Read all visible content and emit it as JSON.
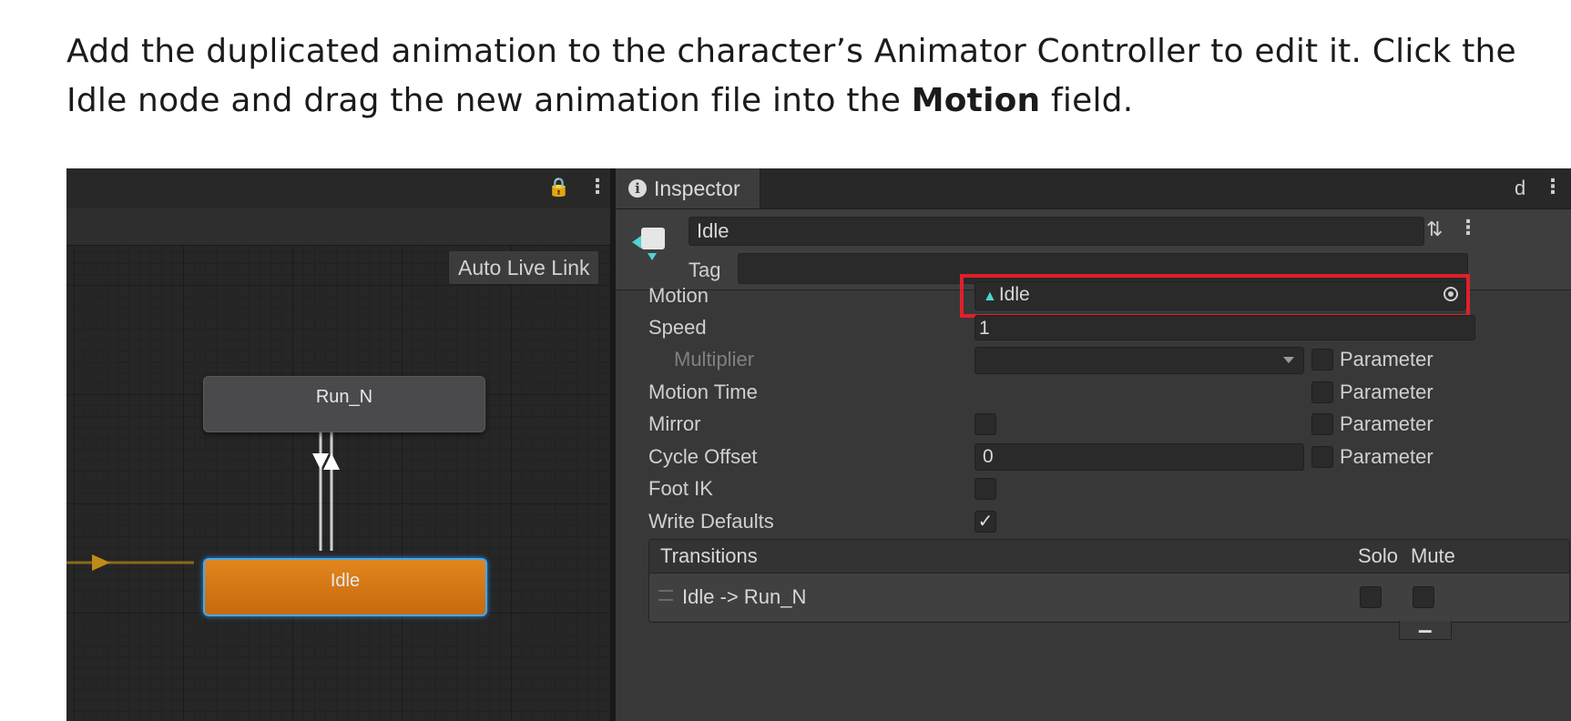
{
  "intro": {
    "before": "Add the duplicated animation to the character’s Animator Controller to edit it. Click the Idle node and drag the new animation file into the ",
    "bold": "Motion",
    "after": " field."
  },
  "animator": {
    "auto_live_link": "Auto Live Link",
    "nodes": {
      "run": "Run_N",
      "idle": "Idle"
    }
  },
  "inspector": {
    "tab_label": "Inspector",
    "state_name": "Idle",
    "tag_label": "Tag",
    "tag_value": "",
    "motion": {
      "label": "Motion",
      "value": "Idle"
    },
    "speed": {
      "label": "Speed",
      "value": "1"
    },
    "multiplier": {
      "label": "Multiplier",
      "parameter": "Parameter"
    },
    "motion_time": {
      "label": "Motion Time",
      "parameter": "Parameter"
    },
    "mirror": {
      "label": "Mirror",
      "parameter": "Parameter"
    },
    "cycle_offset": {
      "label": "Cycle Offset",
      "value": "0",
      "parameter": "Parameter"
    },
    "foot_ik": {
      "label": "Foot IK"
    },
    "write_defaults": {
      "label": "Write Defaults",
      "checked": true
    },
    "transitions": {
      "title": "Transitions",
      "solo": "Solo",
      "mute": "Mute",
      "items": [
        {
          "label": "Idle -> Run_N"
        }
      ]
    }
  },
  "colors": {
    "highlight": "#e0202a",
    "idle_node": "#d7791a",
    "selection": "#44a9f5",
    "clip_icon": "#4fd3d3"
  }
}
